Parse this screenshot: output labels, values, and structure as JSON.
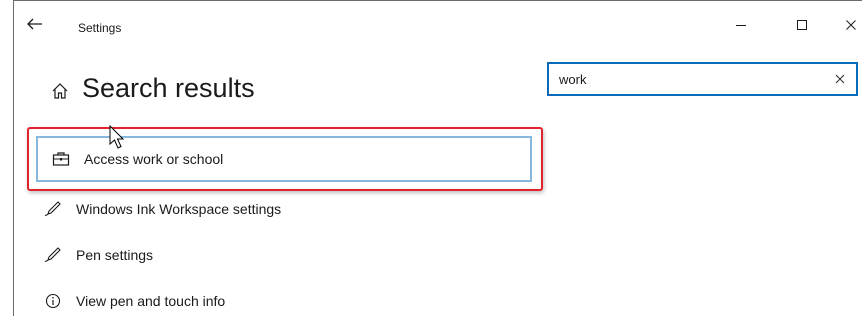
{
  "window": {
    "title": "Settings",
    "controls": {
      "minimize_icon": "minimize-icon",
      "maximize_icon": "maximize-icon",
      "close_icon": "close-icon"
    }
  },
  "header": {
    "back_icon": "back-arrow-icon",
    "home_icon": "home-icon",
    "title": "Search results"
  },
  "search": {
    "value": "work",
    "placeholder": "",
    "clear_icon": "close-icon"
  },
  "results": [
    {
      "label": "Access work or school",
      "icon": "briefcase-icon",
      "selected": true
    },
    {
      "label": "Windows Ink Workspace settings",
      "icon": "pen-icon",
      "selected": false
    },
    {
      "label": "Pen settings",
      "icon": "pen-icon",
      "selected": false
    },
    {
      "label": "View pen and touch info",
      "icon": "info-icon",
      "selected": false
    }
  ],
  "colors": {
    "accent": "#0b6bb8",
    "highlight_border": "#e0232c",
    "selected_border": "#88b8db"
  }
}
